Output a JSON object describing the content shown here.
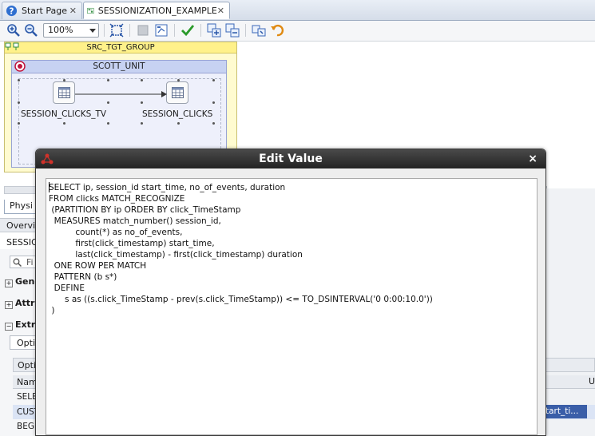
{
  "tabs": [
    {
      "label": "Start Page",
      "icon": "help-icon",
      "closable": true
    },
    {
      "label": "SESSIONIZATION_EXAMPLE",
      "icon": "mapping-icon",
      "closable": true
    }
  ],
  "toolbar": {
    "zoom_value": "100%"
  },
  "diagram": {
    "group_title": "SRC_TGT_GROUP",
    "unit_title": "SCOTT_UNIT",
    "source_node": "SESSION_CLICKS_TV",
    "target_node": "SESSION_CLICKS"
  },
  "lower_panel": {
    "physical_tab": "Physi",
    "overview_tab": "Overvi",
    "session_label": "SESSIO",
    "find_placeholder": "Fi",
    "sections": [
      "Gene",
      "Attri",
      "Extra"
    ],
    "options_tab": "Opti",
    "grid_header1": "Opti",
    "grid_header2": "Nam",
    "column_u": "U",
    "rows": [
      "SELE",
      "CUST",
      "BEGI"
    ],
    "selected_cell": "tart_ti..."
  },
  "dialog": {
    "title": "Edit Value",
    "close_label": "×",
    "sql_lines": [
      "SELECT ip, session_id start_time, no_of_events, duration",
      "FROM clicks MATCH_RECOGNIZE",
      " (PARTITION BY ip ORDER BY click_TimeStamp",
      "  MEASURES match_number() session_id,",
      "          count(*) as no_of_events,",
      "          first(click_timestamp) start_time,",
      "          last(click_timestamp) - first(click_timestamp) duration",
      "  ONE ROW PER MATCH",
      "  PATTERN (b s*)",
      "  DEFINE",
      "      s as ((s.click_TimeStamp - prev(s.click_TimeStamp)) <= TO_DSINTERVAL('0 0:00:10.0'))",
      " )"
    ]
  },
  "colors": {
    "group_fill": "#fffbd0",
    "unit_fill": "#eef0fb",
    "dialog_titlebar": "#2b2b2b",
    "selection": "#3a5ea8"
  }
}
